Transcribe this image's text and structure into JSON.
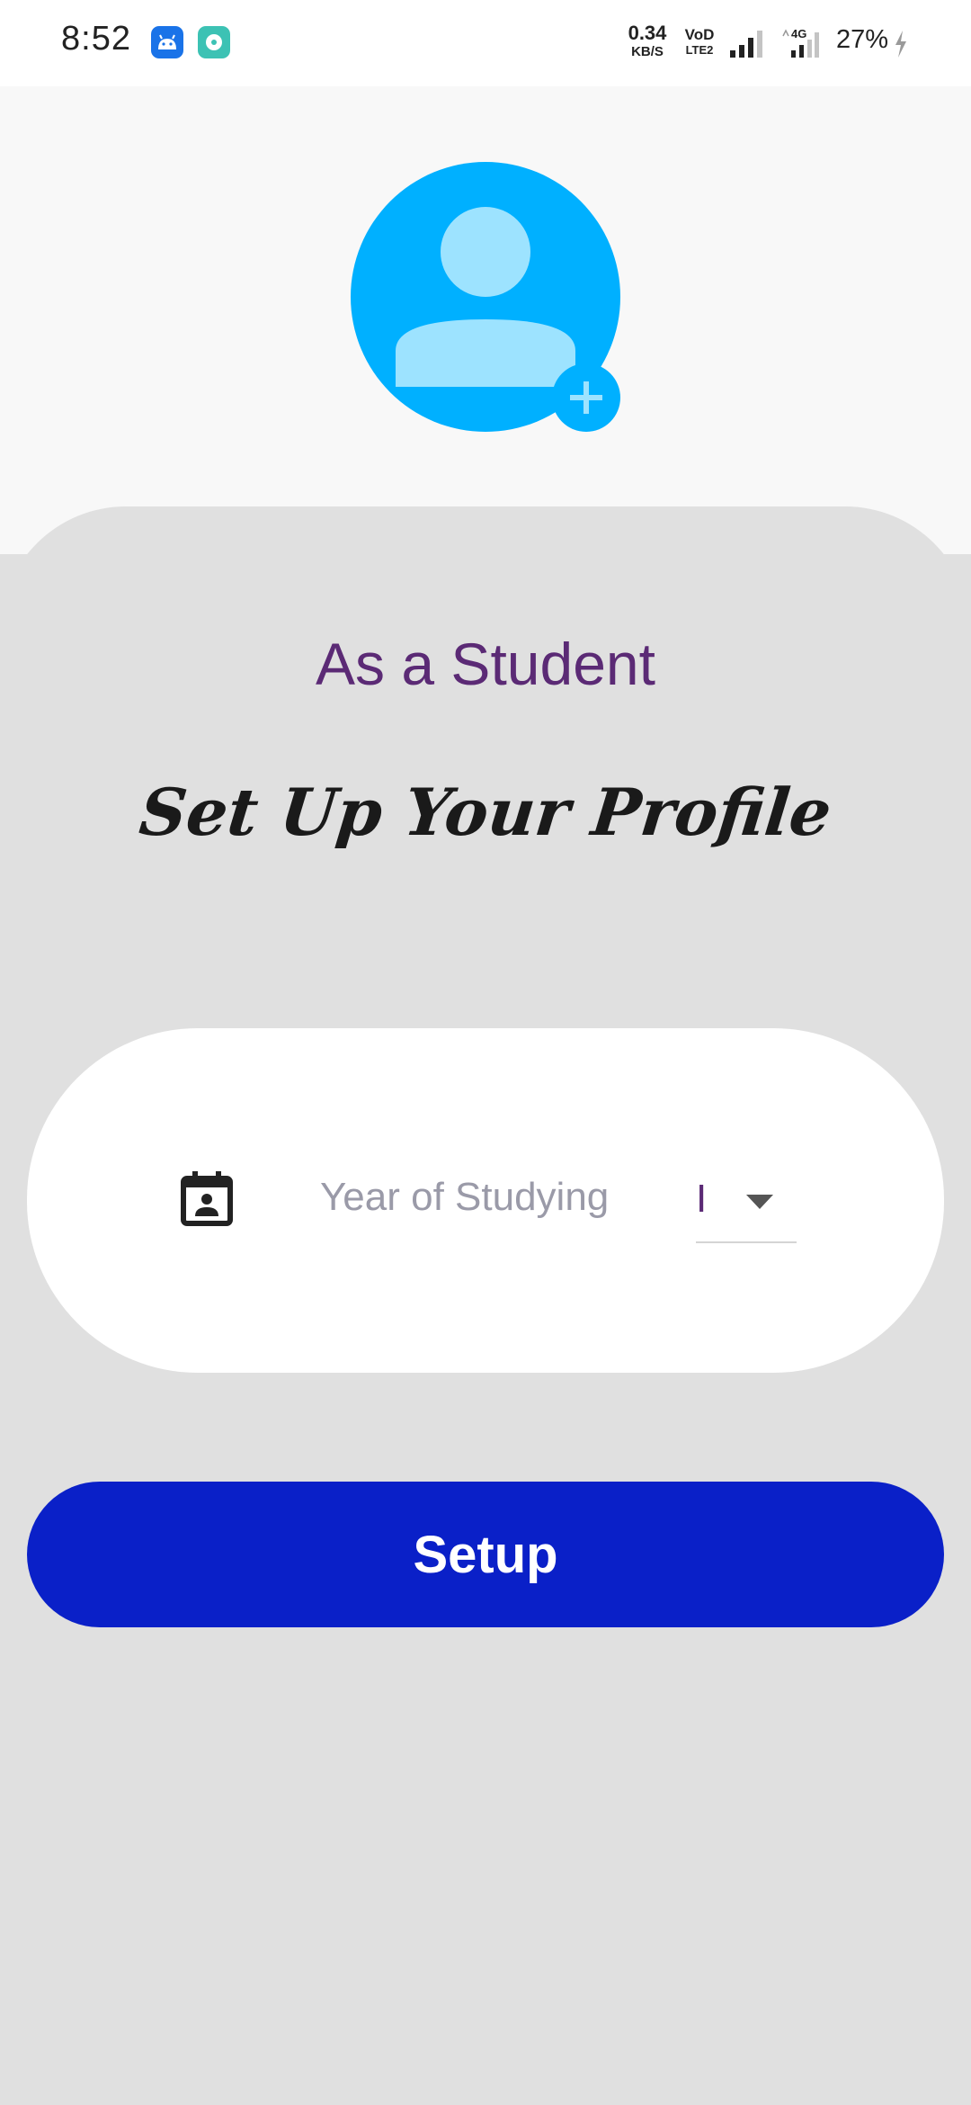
{
  "status_bar": {
    "time": "8:52",
    "net_speed_value": "0.34",
    "net_speed_unit": "KB/S",
    "volte_line1": "VoD",
    "volte_line2": "LTE2",
    "network_type": "4G",
    "battery": "27%",
    "icons": [
      "android-app-icon",
      "disc-app-icon",
      "signal-icon",
      "signal-4g-icon",
      "battery-charging-icon"
    ]
  },
  "profile": {
    "avatar_icon": "person-avatar-icon",
    "add_icon": "plus-icon",
    "avatar_color": "#00b0ff",
    "avatar_figure_color": "#9de3ff"
  },
  "heading": {
    "role": "As a Student",
    "title": "Set Up Your Profile"
  },
  "form": {
    "field_icon": "calendar-person-icon",
    "year_label": "Year of Studying",
    "year_value": "I"
  },
  "actions": {
    "setup_label": "Setup",
    "button_color": "#0a20c8"
  }
}
